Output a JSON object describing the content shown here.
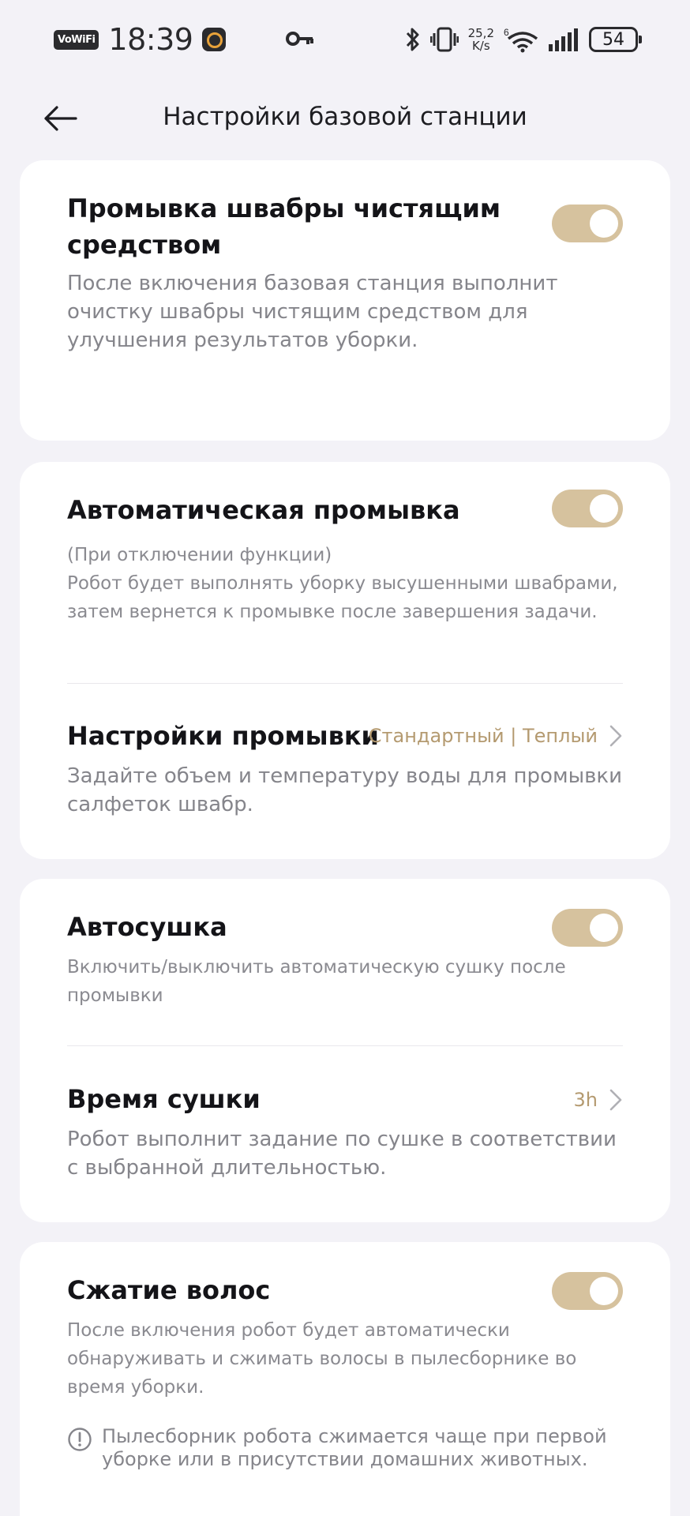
{
  "status_bar": {
    "vowifi": "VoWiFi",
    "time": "18:39",
    "net_speed_value": "25,2",
    "net_speed_unit": "K/s",
    "battery": "54",
    "icons": [
      "app-icon",
      "key-icon",
      "bluetooth-icon",
      "vibrate-icon",
      "wifi-6-icon",
      "signal-icon",
      "battery-icon"
    ]
  },
  "header": {
    "title": "Настройки базовой станции"
  },
  "accent_color": "#d6c29e",
  "value_color": "#b49a70",
  "cards": {
    "detergent": {
      "title": "Промывка швабры чистящим средством",
      "desc": "После включения базовая станция выполнит очистку швабры чистящим средством для улучшения результатов уборки.",
      "toggle_on": true
    },
    "auto_wash": {
      "title": "Автоматическая промывка",
      "desc_line1": "(При отключении функции)",
      "desc_line2": "Робот будет выполнять уборку высушенными швабрами, затем вернется к промывке после завершения задачи.",
      "toggle_on": true
    },
    "wash_settings": {
      "title": "Настройки промывки",
      "value": "Стандартный | Теплый",
      "desc": "Задайте объем и температуру воды для промывки салфеток швабр."
    },
    "auto_dry": {
      "title": "Автосушка",
      "desc": "Включить/выключить автоматическую сушку после промывки",
      "toggle_on": true
    },
    "dry_time": {
      "title": "Время сушки",
      "value": "3h",
      "desc": "Робот выполнит задание по сушке в соответствии с выбранной длительностью."
    },
    "hair_compress": {
      "title": "Сжатие волос",
      "desc": "После включения робот будет автоматически обнаруживать и сжимать волосы в пылесборнике во время уборки.",
      "note": "Пылесборник робота сжимается чаще при первой уборке или в присутствии домашних животных.",
      "toggle_on": true
    }
  }
}
